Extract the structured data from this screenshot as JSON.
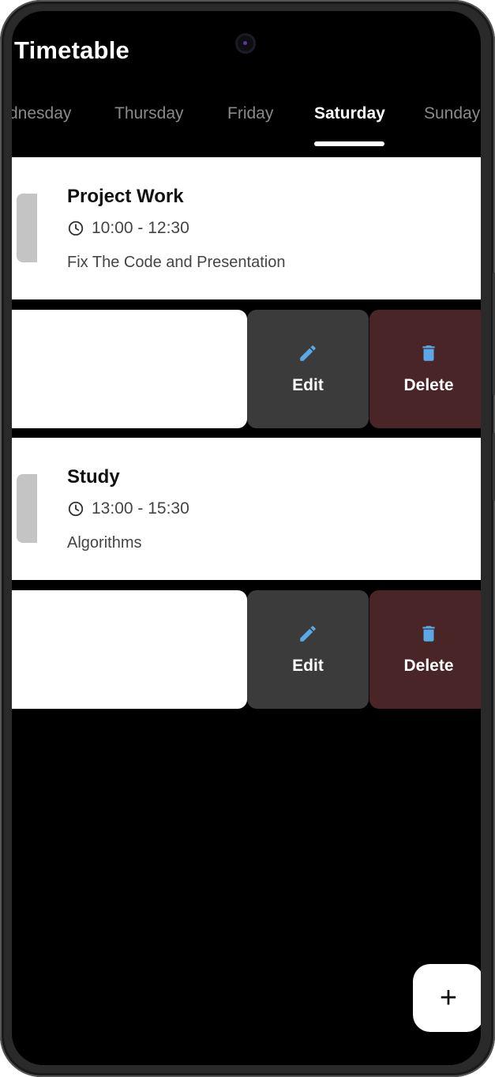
{
  "app": {
    "title": "Timetable"
  },
  "tabs": [
    {
      "label": "dnesday"
    },
    {
      "label": "Thursday"
    },
    {
      "label": "Friday"
    },
    {
      "label": "Saturday",
      "active": true
    },
    {
      "label": "Sunday"
    }
  ],
  "events": [
    {
      "title": "Project Work",
      "time": "10:00 - 12:30",
      "description": "Fix The Code and Presentation"
    },
    {
      "title": "Study",
      "time": "13:00 - 15:30",
      "description": "Algorithms"
    }
  ],
  "actions": {
    "edit_label": "Edit",
    "delete_label": "Delete"
  },
  "fab": {
    "label": "+"
  },
  "icons": {
    "clock": "clock-icon",
    "edit": "pencil-icon",
    "delete": "trash-icon",
    "add": "plus-icon"
  },
  "colors": {
    "background": "#000000",
    "card": "#ffffff",
    "edit_bg": "#3b3b3b",
    "delete_bg": "#4a2528",
    "icon_accent": "#5aa9e6",
    "tab_inactive": "#8a8a8a"
  }
}
